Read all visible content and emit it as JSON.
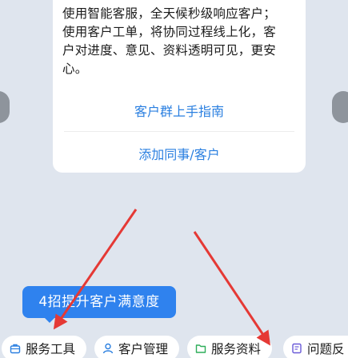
{
  "card": {
    "paragraph_lines": [
      "使用智能客服，全天候秒级响应客户；",
      "使用客户工单，将协同过程线上化，客",
      "户对进度、意见、资料透明可见，更安",
      "心。"
    ],
    "links": [
      "客户群上手指南",
      "添加同事/客户"
    ]
  },
  "callout": {
    "text": "4招提升客户满意度"
  },
  "toolbar": {
    "items": [
      {
        "label": "服务工具",
        "icon": "toolbox-icon",
        "color": "#2a7fe0"
      },
      {
        "label": "客户管理",
        "icon": "user-icon",
        "color": "#2a7fe0"
      },
      {
        "label": "服务资料",
        "icon": "folder-icon",
        "color": "#2fae5a"
      },
      {
        "label": "问题反",
        "icon": "feedback-icon",
        "color": "#6a5ad8"
      }
    ]
  },
  "colors": {
    "background": "#dfe5ee",
    "accent_blue": "#2a7fe0",
    "callout_blue": "#2f82ee",
    "annotation_arrow": "#e53935"
  }
}
